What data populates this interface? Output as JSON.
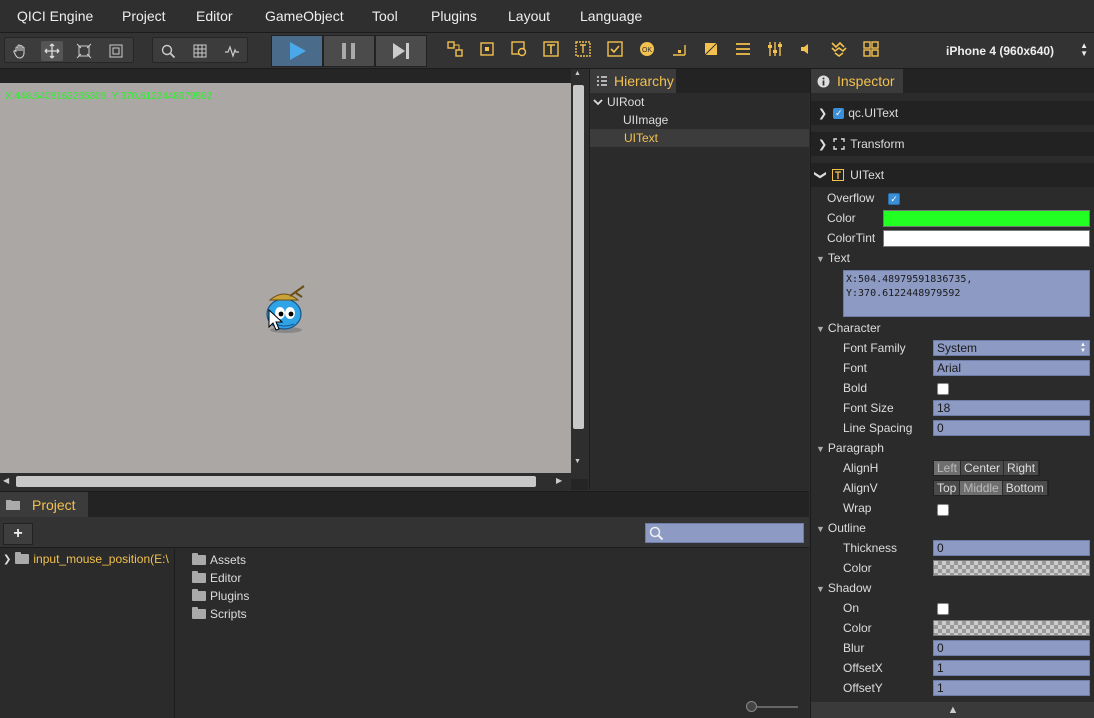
{
  "menubar": {
    "items": [
      "QICI Engine",
      "Project",
      "Editor",
      "GameObject",
      "Tool",
      "Plugins",
      "Layout",
      "Language"
    ]
  },
  "toolbar": {
    "device_select": "iPhone 4 (960x640)"
  },
  "scene": {
    "coordinate_text": "X:448.5408163265306, Y:370.6122448979592"
  },
  "hierarchy": {
    "tab_label": "Hierarchy",
    "items": [
      {
        "label": "UIRoot"
      },
      {
        "label": "UIImage"
      },
      {
        "label": "UIText"
      }
    ]
  },
  "inspector": {
    "tab_label": "Inspector",
    "components": {
      "qc_uitext": "qc.UIText",
      "transform": "Transform",
      "uitext": "UIText"
    },
    "overflow_label": "Overflow",
    "color_label": "Color",
    "color_value": "#22ff22",
    "colortint_label": "ColorTint",
    "colortint_value": "#ffffff",
    "text_section": "Text",
    "text_value": "X:504.48979591836735,\nY:370.6122448979592",
    "character_section": "Character",
    "font_family_label": "Font Family",
    "font_family_value": "System",
    "font_label": "Font",
    "font_value": "Arial",
    "bold_label": "Bold",
    "font_size_label": "Font Size",
    "font_size_value": "18",
    "line_spacing_label": "Line Spacing",
    "line_spacing_value": "0",
    "paragraph_section": "Paragraph",
    "alignh_label": "AlignH",
    "alignh_options": [
      "Left",
      "Center",
      "Right"
    ],
    "alignv_label": "AlignV",
    "alignv_options": [
      "Top",
      "Middle",
      "Bottom"
    ],
    "wrap_label": "Wrap",
    "outline_section": "Outline",
    "thickness_label": "Thickness",
    "thickness_value": "0",
    "outline_color_label": "Color",
    "shadow_section": "Shadow",
    "on_label": "On",
    "shadow_color_label": "Color",
    "blur_label": "Blur",
    "blur_value": "0",
    "offsetx_label": "OffsetX",
    "offsetx_value": "1",
    "offsety_label": "OffsetY",
    "offsety_value": "1"
  },
  "project": {
    "tab_label": "Project",
    "add_label": "+",
    "root_folder": "input_mouse_position(E:\\",
    "folders": [
      "Assets",
      "Editor",
      "Plugins",
      "Scripts"
    ]
  },
  "colors": {
    "accent": "#f2c14e",
    "play_button": "#4aa8e8",
    "field_bg": "#8d9bc4"
  }
}
